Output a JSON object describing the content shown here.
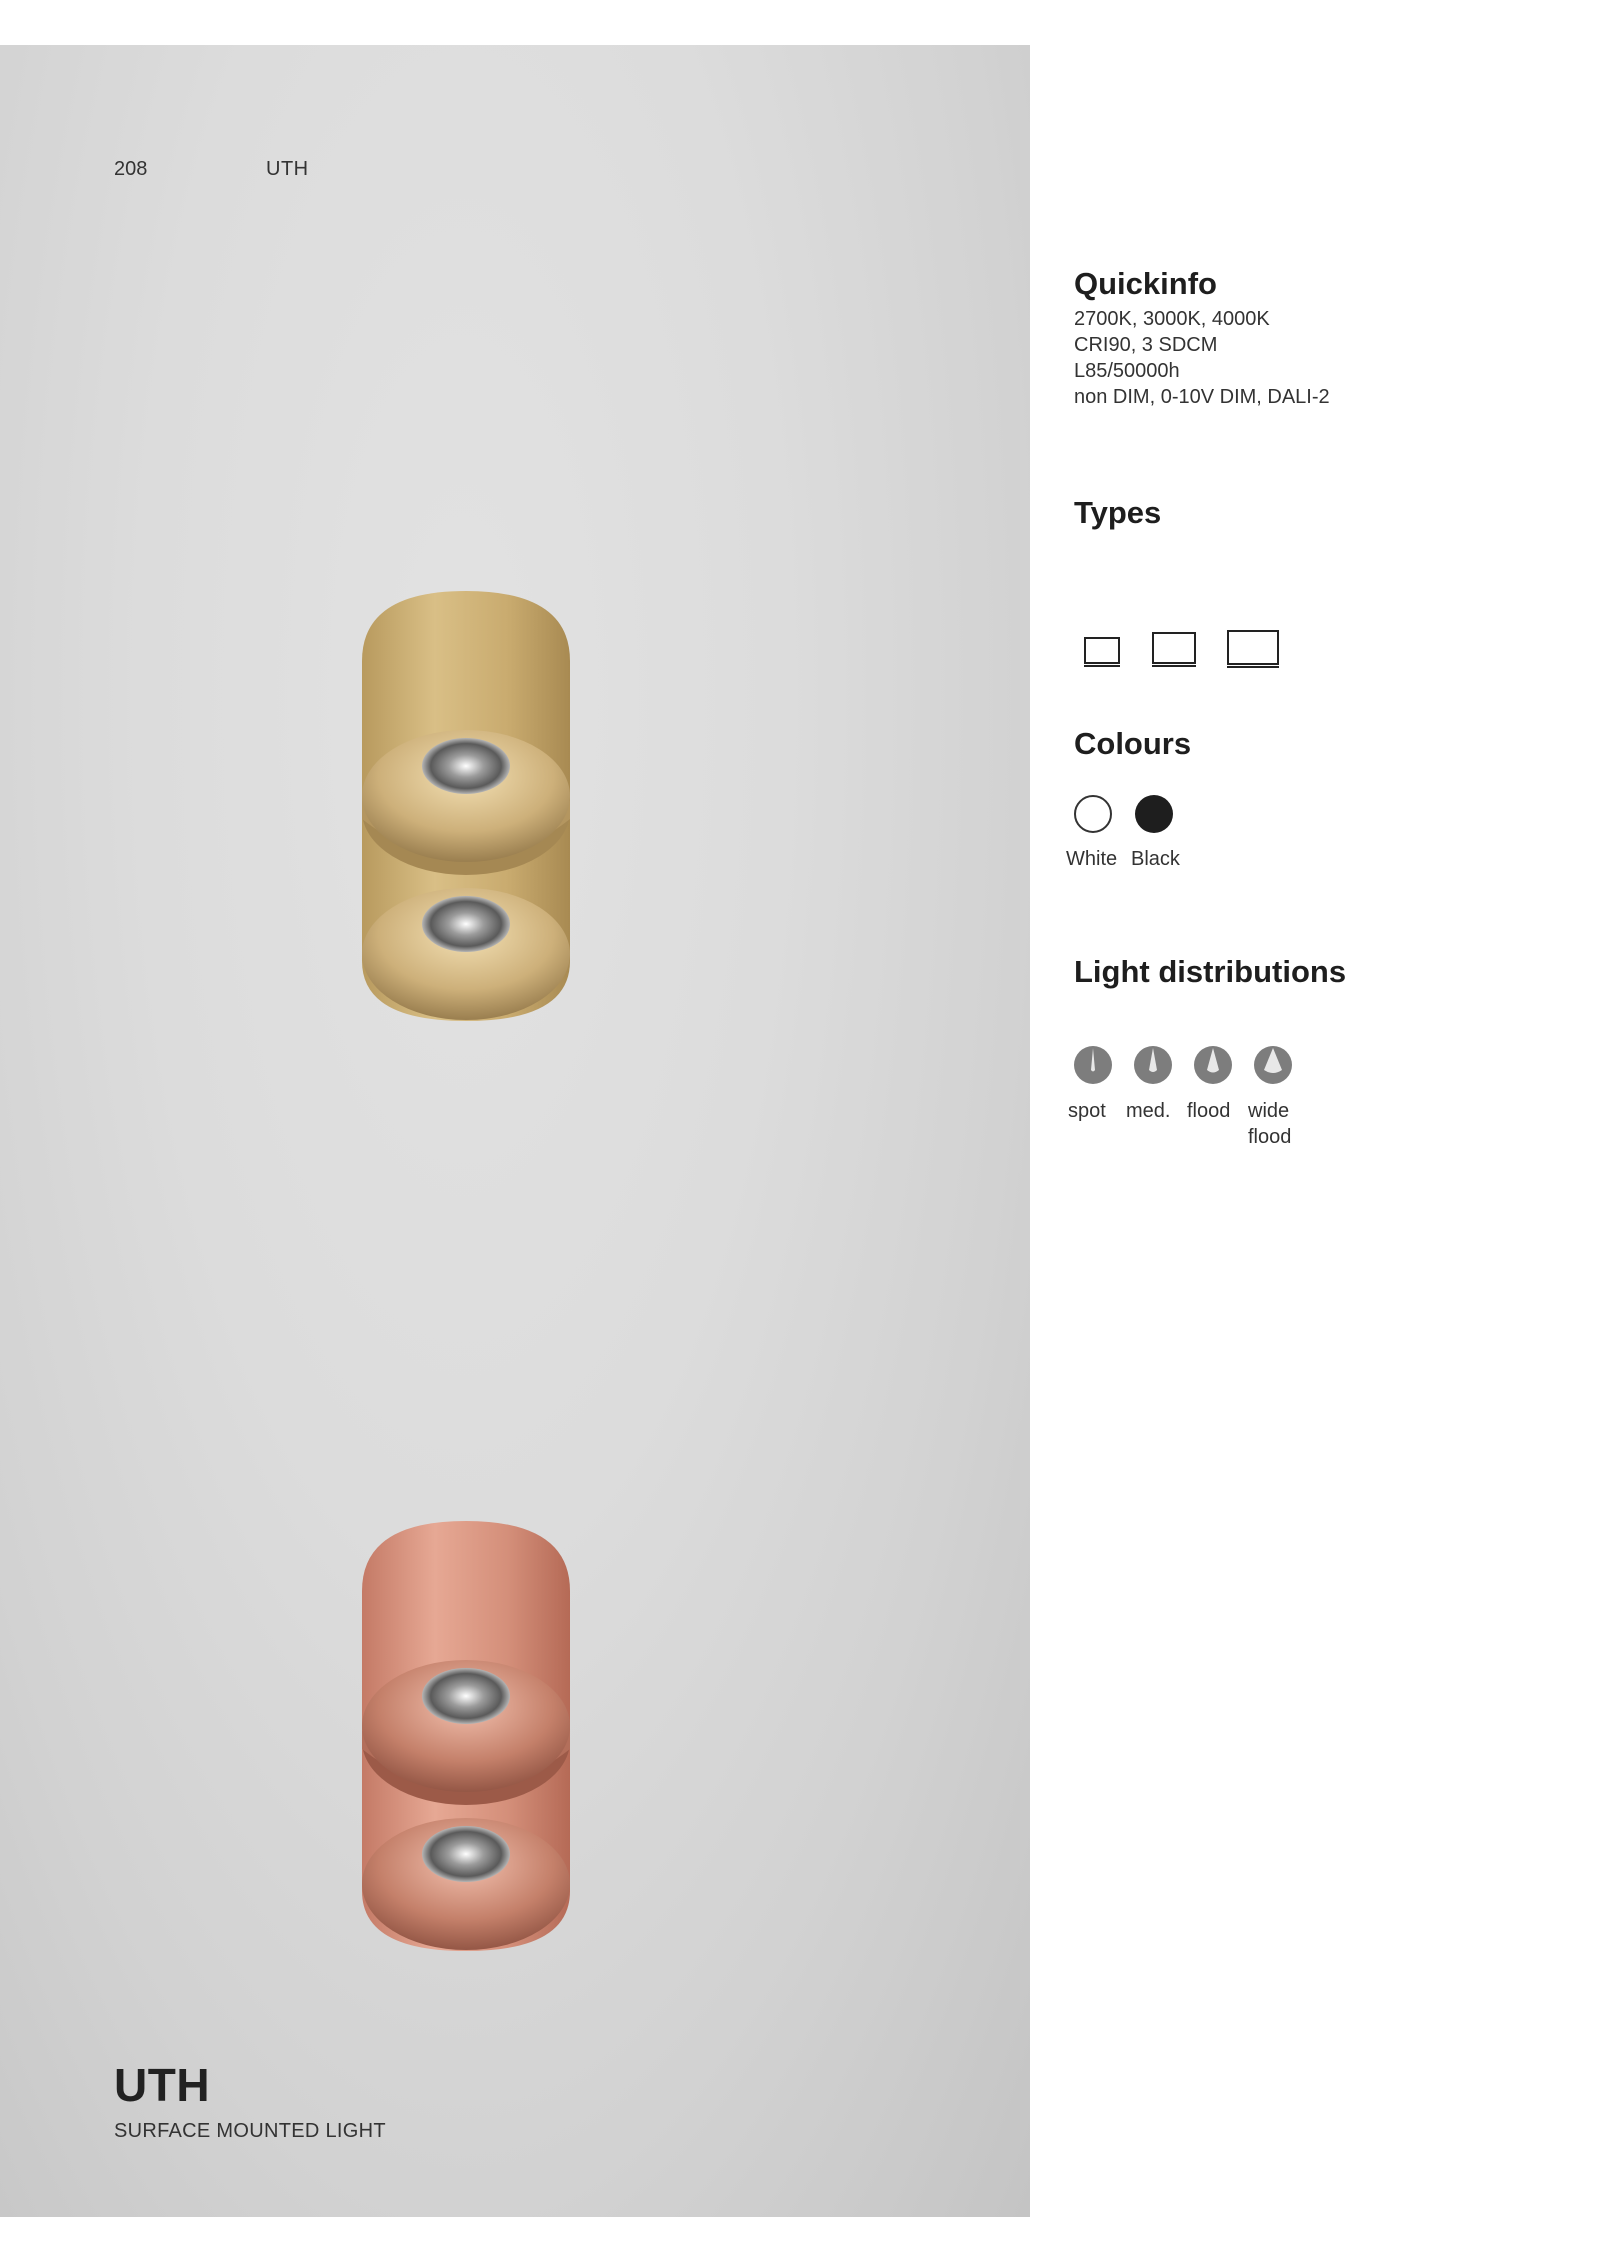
{
  "header": {
    "page_number": "208",
    "product_code": "UTH"
  },
  "product": {
    "title": "UTH",
    "subtitle": "SURFACE MOUNTED LIGHT",
    "finishes_shown": [
      "gold",
      "copper"
    ]
  },
  "quickinfo": {
    "heading": "Quickinfo",
    "lines": [
      "2700K,  3000K,  4000K",
      "CRI90, 3 SDCM",
      "L85/50000h",
      "non DIM, 0-10V DIM, DALI-2"
    ]
  },
  "types": {
    "heading": "Types",
    "count": 3
  },
  "colours": {
    "heading": "Colours",
    "items": [
      {
        "label": "White",
        "color": "#ffffff"
      },
      {
        "label": "Black",
        "color": "#1e1e1e"
      }
    ]
  },
  "light_distributions": {
    "heading": "Light distributions",
    "items": [
      {
        "label": "spot",
        "icon": "spot-beam-icon"
      },
      {
        "label": "med.",
        "icon": "medium-beam-icon"
      },
      {
        "label": "flood",
        "icon": "flood-beam-icon"
      },
      {
        "label_line1": "wide",
        "label_line2": "flood",
        "icon": "wide-flood-beam-icon"
      }
    ]
  }
}
